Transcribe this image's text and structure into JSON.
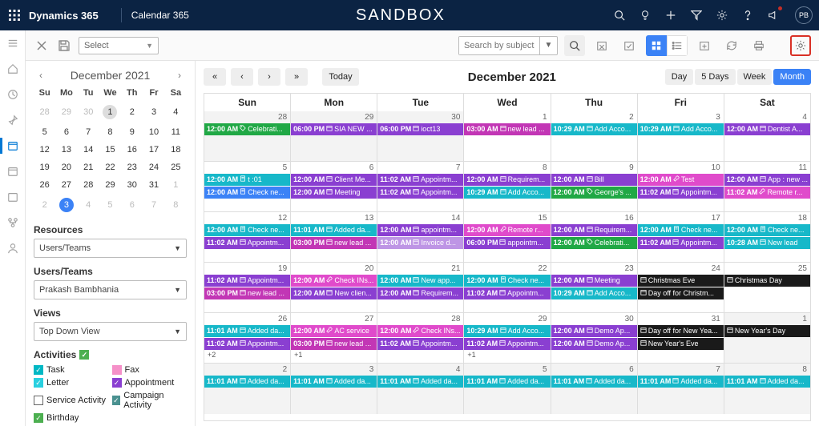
{
  "topbar": {
    "brand": "Dynamics 365",
    "app_name": "Calendar 365",
    "center_label": "SANDBOX",
    "avatar_initials": "PB"
  },
  "toolbar": {
    "select_label": "Select",
    "search_placeholder": "Search by subject"
  },
  "mini_cal": {
    "title": "December 2021",
    "dow": [
      "Su",
      "Mo",
      "Tu",
      "We",
      "Th",
      "Fr",
      "Sa"
    ],
    "weeks": [
      [
        {
          "d": "28",
          "o": true
        },
        {
          "d": "29",
          "o": true
        },
        {
          "d": "30",
          "o": true
        },
        {
          "d": "1",
          "today": true
        },
        {
          "d": "2"
        },
        {
          "d": "3"
        },
        {
          "d": "4"
        }
      ],
      [
        {
          "d": "5"
        },
        {
          "d": "6"
        },
        {
          "d": "7"
        },
        {
          "d": "8"
        },
        {
          "d": "9"
        },
        {
          "d": "10"
        },
        {
          "d": "11"
        }
      ],
      [
        {
          "d": "12"
        },
        {
          "d": "13"
        },
        {
          "d": "14"
        },
        {
          "d": "15"
        },
        {
          "d": "16"
        },
        {
          "d": "17"
        },
        {
          "d": "18"
        }
      ],
      [
        {
          "d": "19"
        },
        {
          "d": "20"
        },
        {
          "d": "21"
        },
        {
          "d": "22"
        },
        {
          "d": "23"
        },
        {
          "d": "24"
        },
        {
          "d": "25"
        }
      ],
      [
        {
          "d": "26"
        },
        {
          "d": "27"
        },
        {
          "d": "28"
        },
        {
          "d": "29"
        },
        {
          "d": "30"
        },
        {
          "d": "31"
        },
        {
          "d": "1",
          "o": true
        }
      ],
      [
        {
          "d": "2",
          "o": true
        },
        {
          "d": "3",
          "o": true,
          "sel": true
        },
        {
          "d": "4",
          "o": true
        },
        {
          "d": "5",
          "o": true
        },
        {
          "d": "6",
          "o": true
        },
        {
          "d": "7",
          "o": true
        },
        {
          "d": "8",
          "o": true
        }
      ]
    ]
  },
  "panels": {
    "resources_label": "Resources",
    "resources_value": "Users/Teams",
    "usersteams_label": "Users/Teams",
    "usersteams_value": "Prakash Bambhania",
    "views_label": "Views",
    "views_value": "Top Down View",
    "activities_label": "Activities",
    "activities": [
      {
        "name": "Task",
        "sw": "task",
        "chk": true
      },
      {
        "name": "Fax",
        "sw": "fax",
        "chk": false
      },
      {
        "name": "Letter",
        "sw": "letter",
        "chk": true
      },
      {
        "name": "Appointment",
        "sw": "appt",
        "chk": true
      },
      {
        "name": "Service Activity",
        "sw": "svc",
        "chk": false
      },
      {
        "name": "Campaign Activity",
        "sw": "camp",
        "chk": true
      },
      {
        "name": "Birthday",
        "sw": "bday",
        "chk": true
      }
    ]
  },
  "big_cal": {
    "today_label": "Today",
    "title": "December 2021",
    "views": [
      "Day",
      "5 Days",
      "Week",
      "Month"
    ],
    "active_view": "Month",
    "dow": [
      "Sun",
      "Mon",
      "Tue",
      "Wed",
      "Thu",
      "Fri",
      "Sat"
    ],
    "weeks": [
      [
        {
          "num": "28",
          "grey": true,
          "events": [
            {
              "t": "12:00 AM",
              "i": "tag",
              "txt": "Celebrati...",
              "c": "c-green"
            }
          ]
        },
        {
          "num": "29",
          "grey": true,
          "events": [
            {
              "t": "06:00 PM",
              "i": "cal",
              "txt": "SIA NEW ...",
              "c": "c-purple"
            }
          ]
        },
        {
          "num": "30",
          "grey": true,
          "events": [
            {
              "t": "06:00 PM",
              "i": "cal",
              "txt": "ioct13",
              "c": "c-purple"
            }
          ]
        },
        {
          "num": "1",
          "events": [
            {
              "t": "03:00 AM",
              "i": "cal",
              "txt": "new lead ...",
              "c": "c-magenta"
            }
          ]
        },
        {
          "num": "2",
          "events": [
            {
              "t": "10:29 AM",
              "i": "cal",
              "txt": "Add Acco...",
              "c": "c-cyan"
            }
          ]
        },
        {
          "num": "3",
          "events": [
            {
              "t": "10:29 AM",
              "i": "cal",
              "txt": "Add Acco...",
              "c": "c-cyan"
            }
          ]
        },
        {
          "num": "4",
          "events": [
            {
              "t": "12:00 AM",
              "i": "cal",
              "txt": "Dentist A...",
              "c": "c-purple"
            }
          ]
        }
      ],
      [
        {
          "num": "5",
          "events": [
            {
              "t": "12:00 AM",
              "i": "doc",
              "txt": "t :01",
              "c": "c-cyan"
            },
            {
              "t": "12:00 AM",
              "i": "doc",
              "txt": "Check ne...",
              "c": "c-blue"
            }
          ]
        },
        {
          "num": "6",
          "events": [
            {
              "t": "12:00 AM",
              "i": "cal",
              "txt": "Client Me...",
              "c": "c-purple"
            },
            {
              "t": "12:00 AM",
              "i": "cal",
              "txt": "Meeting",
              "c": "c-purple"
            }
          ]
        },
        {
          "num": "7",
          "events": [
            {
              "t": "11:02 AM",
              "i": "cal",
              "txt": "Appointm...",
              "c": "c-purple"
            },
            {
              "t": "11:02 AM",
              "i": "cal",
              "txt": "Appointm...",
              "c": "c-purple"
            }
          ]
        },
        {
          "num": "8",
          "events": [
            {
              "t": "12:00 AM",
              "i": "cal",
              "txt": "Requirem...",
              "c": "c-purple"
            },
            {
              "t": "10:29 AM",
              "i": "cal",
              "txt": "Add Acco...",
              "c": "c-cyan"
            }
          ]
        },
        {
          "num": "9",
          "events": [
            {
              "t": "12:00 AM",
              "i": "cal",
              "txt": "Bill",
              "c": "c-purple"
            },
            {
              "t": "12:00 AM",
              "i": "tag",
              "txt": "George's ...",
              "c": "c-green"
            }
          ]
        },
        {
          "num": "10",
          "events": [
            {
              "t": "12:00 AM",
              "i": "wrench",
              "txt": "Test",
              "c": "c-pink"
            },
            {
              "t": "11:02 AM",
              "i": "cal",
              "txt": "Appointm...",
              "c": "c-purple"
            }
          ]
        },
        {
          "num": "11",
          "events": [
            {
              "t": "12:00 AM",
              "i": "cal",
              "txt": "App : new ...",
              "c": "c-purple"
            },
            {
              "t": "11:02 AM",
              "i": "wrench",
              "txt": "Remote r...",
              "c": "c-pink"
            }
          ]
        }
      ],
      [
        {
          "num": "12",
          "events": [
            {
              "t": "12:00 AM",
              "i": "doc",
              "txt": "Check ne...",
              "c": "c-cyan"
            },
            {
              "t": "11:02 AM",
              "i": "cal",
              "txt": "Appointm...",
              "c": "c-purple"
            }
          ]
        },
        {
          "num": "13",
          "events": [
            {
              "t": "11:01 AM",
              "i": "cal",
              "txt": "Added da...",
              "c": "c-cyan"
            },
            {
              "t": "03:00 PM",
              "i": "cal",
              "txt": "new lead ...",
              "c": "c-magenta"
            }
          ]
        },
        {
          "num": "14",
          "events": [
            {
              "t": "12:00 AM",
              "i": "cal",
              "txt": "appointm...",
              "c": "c-purple"
            },
            {
              "t": "12:00 AM",
              "i": "cal",
              "txt": "Invoice d...",
              "c": "c-purple",
              "faded": true
            }
          ]
        },
        {
          "num": "15",
          "events": [
            {
              "t": "12:00 AM",
              "i": "wrench",
              "txt": "Remote r...",
              "c": "c-pink"
            },
            {
              "t": "06:00 PM",
              "i": "cal",
              "txt": "appointm...",
              "c": "c-purple"
            }
          ]
        },
        {
          "num": "16",
          "events": [
            {
              "t": "12:00 AM",
              "i": "cal",
              "txt": "Requirem...",
              "c": "c-purple"
            },
            {
              "t": "12:00 AM",
              "i": "tag",
              "txt": "Celebrati...",
              "c": "c-green"
            }
          ]
        },
        {
          "num": "17",
          "events": [
            {
              "t": "12:00 AM",
              "i": "doc",
              "txt": "Check ne...",
              "c": "c-cyan"
            },
            {
              "t": "11:02 AM",
              "i": "cal",
              "txt": "Appointm...",
              "c": "c-purple"
            }
          ]
        },
        {
          "num": "18",
          "events": [
            {
              "t": "12:00 AM",
              "i": "doc",
              "txt": "Check ne...",
              "c": "c-cyan"
            },
            {
              "t": "10:28 AM",
              "i": "cal",
              "txt": "New lead",
              "c": "c-cyan"
            }
          ]
        }
      ],
      [
        {
          "num": "19",
          "events": [
            {
              "t": "11:02 AM",
              "i": "cal",
              "txt": "Appointm...",
              "c": "c-purple"
            },
            {
              "t": "03:00 PM",
              "i": "cal",
              "txt": "new lead ...",
              "c": "c-magenta"
            }
          ]
        },
        {
          "num": "20",
          "events": [
            {
              "t": "12:00 AM",
              "i": "wrench",
              "txt": "Check INs...",
              "c": "c-pink"
            },
            {
              "t": "12:00 AM",
              "i": "cal",
              "txt": "New clien...",
              "c": "c-purple"
            }
          ]
        },
        {
          "num": "21",
          "events": [
            {
              "t": "12:00 AM",
              "i": "cal",
              "txt": "New app...",
              "c": "c-cyan"
            },
            {
              "t": "12:00 AM",
              "i": "cal",
              "txt": "Requirem...",
              "c": "c-purple"
            }
          ]
        },
        {
          "num": "22",
          "events": [
            {
              "t": "12:00 AM",
              "i": "doc",
              "txt": "Check ne...",
              "c": "c-cyan"
            },
            {
              "t": "11:02 AM",
              "i": "cal",
              "txt": "Appointm...",
              "c": "c-purple"
            }
          ]
        },
        {
          "num": "23",
          "events": [
            {
              "t": "12:00 AM",
              "i": "cal",
              "txt": "Meeting",
              "c": "c-purple"
            },
            {
              "t": "10:29 AM",
              "i": "cal",
              "txt": "Add Acco...",
              "c": "c-cyan"
            }
          ]
        },
        {
          "num": "24",
          "events": [
            {
              "t": "",
              "i": "cal",
              "txt": "Christmas Eve",
              "c": "c-black"
            },
            {
              "t": "",
              "i": "cal",
              "txt": "Day off for Christm...",
              "c": "c-black"
            }
          ]
        },
        {
          "num": "25",
          "events": [
            {
              "t": "",
              "i": "cal",
              "txt": "Christmas Day",
              "c": "c-black"
            }
          ]
        }
      ],
      [
        {
          "num": "26",
          "events": [
            {
              "t": "11:01 AM",
              "i": "cal",
              "txt": "Added da...",
              "c": "c-cyan"
            },
            {
              "t": "11:02 AM",
              "i": "cal",
              "txt": "Appointm...",
              "c": "c-purple"
            }
          ],
          "more": "+2"
        },
        {
          "num": "27",
          "events": [
            {
              "t": "12:00 AM",
              "i": "wrench",
              "txt": "AC service",
              "c": "c-pink"
            },
            {
              "t": "03:00 PM",
              "i": "cal",
              "txt": "new lead ...",
              "c": "c-magenta"
            }
          ],
          "more": "+1"
        },
        {
          "num": "28",
          "events": [
            {
              "t": "12:00 AM",
              "i": "wrench",
              "txt": "Check INs...",
              "c": "c-pink"
            },
            {
              "t": "11:02 AM",
              "i": "cal",
              "txt": "Appointm...",
              "c": "c-purple"
            }
          ]
        },
        {
          "num": "29",
          "events": [
            {
              "t": "10:29 AM",
              "i": "cal",
              "txt": "Add Acco...",
              "c": "c-cyan"
            },
            {
              "t": "11:02 AM",
              "i": "cal",
              "txt": "Appointm...",
              "c": "c-purple"
            }
          ],
          "more": "+1"
        },
        {
          "num": "30",
          "events": [
            {
              "t": "12:00 AM",
              "i": "cal",
              "txt": "Demo Ap...",
              "c": "c-purple"
            },
            {
              "t": "12:00 AM",
              "i": "cal",
              "txt": "Demo Ap...",
              "c": "c-purple"
            }
          ]
        },
        {
          "num": "31",
          "events": [
            {
              "t": "",
              "i": "cal",
              "txt": "Day off for New Yea...",
              "c": "c-black"
            },
            {
              "t": "",
              "i": "cal",
              "txt": "New Year's Eve",
              "c": "c-black"
            }
          ]
        },
        {
          "num": "1",
          "grey": true,
          "events": [
            {
              "t": "",
              "i": "cal",
              "txt": "New Year's Day",
              "c": "c-black"
            }
          ]
        }
      ],
      [
        {
          "num": "2",
          "grey": true,
          "events": [
            {
              "t": "11:01 AM",
              "i": "cal",
              "txt": "Added da...",
              "c": "c-cyan"
            }
          ]
        },
        {
          "num": "3",
          "grey": true,
          "events": [
            {
              "t": "11:01 AM",
              "i": "cal",
              "txt": "Added da...",
              "c": "c-cyan"
            }
          ]
        },
        {
          "num": "4",
          "grey": true,
          "events": [
            {
              "t": "11:01 AM",
              "i": "cal",
              "txt": "Added da...",
              "c": "c-cyan"
            }
          ]
        },
        {
          "num": "5",
          "grey": true,
          "events": [
            {
              "t": "11:01 AM",
              "i": "cal",
              "txt": "Added da...",
              "c": "c-cyan"
            }
          ]
        },
        {
          "num": "6",
          "grey": true,
          "events": [
            {
              "t": "11:01 AM",
              "i": "cal",
              "txt": "Added da...",
              "c": "c-cyan"
            }
          ]
        },
        {
          "num": "7",
          "grey": true,
          "events": [
            {
              "t": "11:01 AM",
              "i": "cal",
              "txt": "Added da...",
              "c": "c-cyan"
            }
          ]
        },
        {
          "num": "8",
          "grey": true,
          "events": [
            {
              "t": "11:01 AM",
              "i": "cal",
              "txt": "Added da...",
              "c": "c-cyan"
            }
          ]
        }
      ]
    ]
  }
}
